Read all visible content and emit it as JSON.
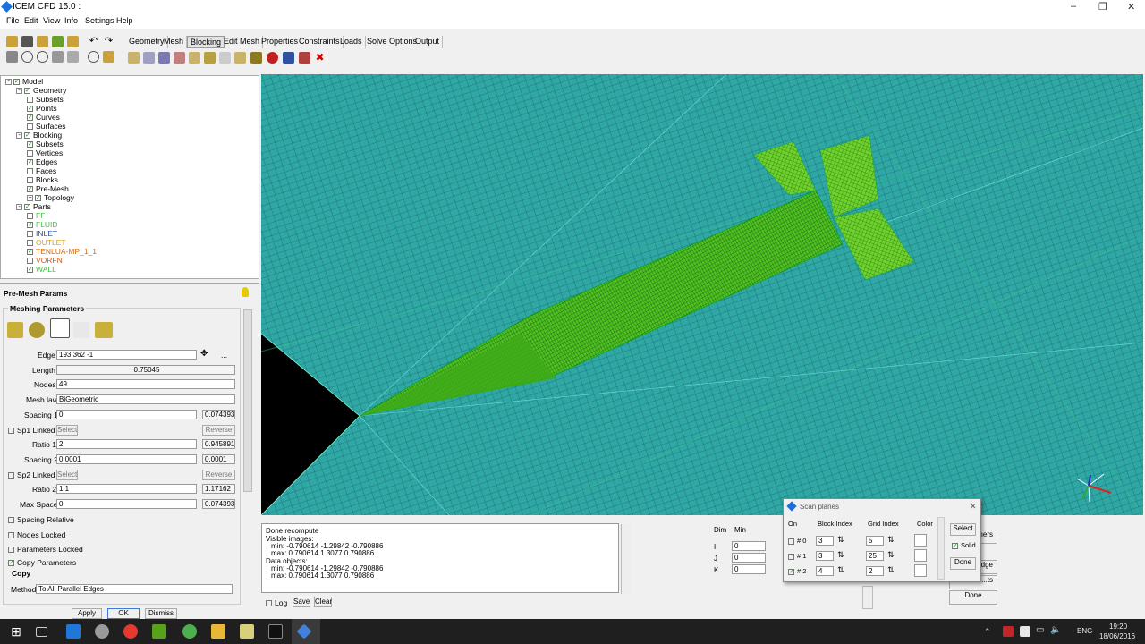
{
  "window": {
    "title": "ICEM CFD 15.0 :",
    "min": "–",
    "max": "❐",
    "close": "✕"
  },
  "menu": [
    "File",
    "Edit",
    "View",
    "Info",
    "Settings",
    "Help"
  ],
  "tabs": [
    "Geometry",
    "Mesh",
    "Blocking",
    "Edit Mesh",
    "Properties",
    "Constraints",
    "Loads",
    "Solve Options",
    "Output"
  ],
  "active_tab": "Blocking",
  "tree": [
    {
      "label": "Model",
      "lvl": 0,
      "cb": "on",
      "exp": "-"
    },
    {
      "label": "Geometry",
      "lvl": 1,
      "cb": "on",
      "exp": "-"
    },
    {
      "label": "Subsets",
      "lvl": 2,
      "cb": "off"
    },
    {
      "label": "Points",
      "lvl": 2,
      "cb": "on"
    },
    {
      "label": "Curves",
      "lvl": 2,
      "cb": "on"
    },
    {
      "label": "Surfaces",
      "lvl": 2,
      "cb": "off"
    },
    {
      "label": "Blocking",
      "lvl": 1,
      "cb": "on",
      "exp": "-"
    },
    {
      "label": "Subsets",
      "lvl": 2,
      "cb": "on"
    },
    {
      "label": "Vertices",
      "lvl": 2,
      "cb": "off"
    },
    {
      "label": "Edges",
      "lvl": 2,
      "cb": "on"
    },
    {
      "label": "Faces",
      "lvl": 2,
      "cb": "off"
    },
    {
      "label": "Blocks",
      "lvl": 2,
      "cb": "off"
    },
    {
      "label": "Pre-Mesh",
      "lvl": 2,
      "cb": "on"
    },
    {
      "label": "Topology",
      "lvl": 2,
      "cb": "on",
      "exp": "+"
    },
    {
      "label": "Parts",
      "lvl": 1,
      "cb": "on",
      "exp": "-"
    },
    {
      "label": "FF",
      "lvl": 2,
      "cb": "off",
      "color": "#3fbf3f"
    },
    {
      "label": "FLUID",
      "lvl": 2,
      "cb": "on",
      "color": "#3fbf3f"
    },
    {
      "label": "INLET",
      "lvl": 2,
      "cb": "off",
      "color": "#1a4fbf"
    },
    {
      "label": "OUTLET",
      "lvl": 2,
      "cb": "off",
      "color": "#d9a000"
    },
    {
      "label": "TENLUA-MP_1_1",
      "lvl": 2,
      "cb": "on",
      "color": "#d46a00"
    },
    {
      "label": "VORFN",
      "lvl": 2,
      "cb": "off",
      "color": "#d05a1a"
    },
    {
      "label": "WALL",
      "lvl": 2,
      "cb": "on",
      "color": "#3fbf3f"
    }
  ],
  "premesh": {
    "title": "Pre-Mesh Params",
    "group": "Meshing Parameters",
    "edge_label": "Edge",
    "edge_value": "193 362 -1",
    "length_label": "Length",
    "length_value": "0.75045",
    "nodes_label": "Nodes",
    "nodes_value": "49",
    "meshlaw_label": "Mesh law",
    "meshlaw_value": "BiGeometric",
    "spacing1_label": "Spacing 1",
    "spacing1_value": "0",
    "spacing1_actual": "0.0743935",
    "sp1linked_label": "Sp1 Linked",
    "select": "Select",
    "reverse": "Reverse",
    "ratio1_label": "Ratio 1",
    "ratio1_value": "2",
    "ratio1_actual": "0.945891",
    "spacing2_label": "Spacing 2",
    "spacing2_value": "0.0001",
    "spacing2_actual": "0.0001",
    "sp2linked_label": "Sp2 Linked",
    "ratio2_label": "Ratio 2",
    "ratio2_value": "1.1",
    "ratio2_actual": "1.17162",
    "maxspace_label": "Max Space",
    "maxspace_value": "0",
    "maxspace_actual": "0.0743935",
    "spacing_relative": "Spacing Relative",
    "nodes_locked": "Nodes Locked",
    "params_locked": "Parameters Locked",
    "copy_params": "Copy Parameters",
    "copy_group": "Copy",
    "method_label": "Method",
    "method_value": "To All Parallel Edges",
    "apply": "Apply",
    "ok": "OK",
    "dismiss": "Dismiss",
    "ellipsis": "..."
  },
  "console": {
    "lines": [
      "Done recompute",
      "Visible images:",
      "   min: -0.790614 -1.29842 -0.790886",
      "   max: 0.790614 1.3077 0.790886",
      "Data objects:",
      "   min: -0.790614 -1.29842 -0.790886",
      "   max: 0.790614 1.3077 0.790886"
    ],
    "log": "Log",
    "save": "Save",
    "clear": "Clear"
  },
  "dims": {
    "dim": "Dim",
    "min": "Min",
    "rows": [
      {
        "axis": "I",
        "val": "0"
      },
      {
        "axis": "J",
        "val": "0"
      },
      {
        "axis": "K",
        "val": "0"
      }
    ]
  },
  "side_buttons": [
    "...ners",
    "Solid",
    "...dge",
    "...ts",
    "Done"
  ],
  "scan": {
    "title": "Scan planes",
    "on": "On",
    "block_index": "Block Index",
    "grid_index": "Grid Index",
    "color": "Color",
    "rows": [
      {
        "id": "# 0",
        "checked": false,
        "block": "3",
        "grid": "5"
      },
      {
        "id": "# 1",
        "checked": false,
        "block": "3",
        "grid": "25"
      },
      {
        "id": "# 2",
        "checked": true,
        "block": "4",
        "grid": "2"
      }
    ],
    "select": "Select",
    "solid": "Solid",
    "done": "Done",
    "close": "✕"
  },
  "tray": {
    "lang": "ENG",
    "time": "19:20",
    "date": "18/06/2016"
  }
}
